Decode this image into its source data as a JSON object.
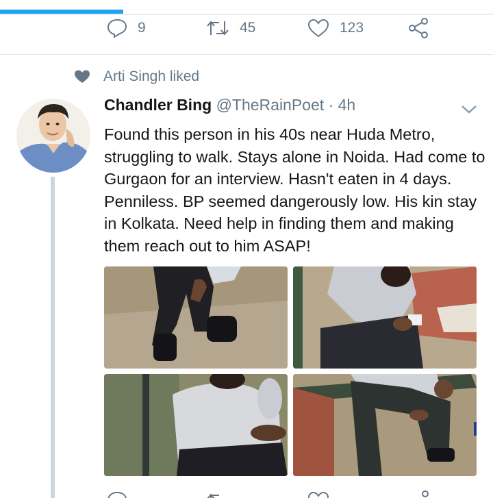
{
  "previous_tweet": {
    "reply_count": "9",
    "retweet_count": "45",
    "like_count": "123"
  },
  "social_context": {
    "icon": "heart-icon",
    "text": "Arti Singh liked"
  },
  "tweet": {
    "author_name": "Chandler Bing",
    "handle": "@TheRainPoet",
    "separator": "·",
    "time": "4h",
    "text": "Found this person in his 40s near Huda Metro, struggling to walk. Stays alone in Noida. Had come to Gurgaon for an interview. Hasn't eaten in 4 days. Penniless. BP seemed dangerously low. His kin stay in Kolkata. Need help in finding them and making them reach out to him ASAP!",
    "photos": [
      "photo-1",
      "photo-2",
      "photo-3",
      "photo-4"
    ]
  },
  "colors": {
    "accent": "#1da1f2",
    "secondary_text": "#657786",
    "thread_line": "#ccd6dd"
  }
}
